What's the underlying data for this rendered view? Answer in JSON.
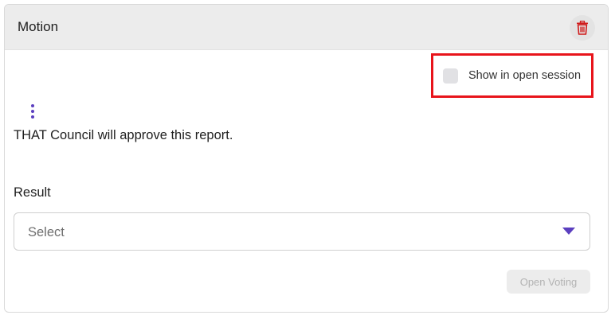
{
  "card": {
    "title": "Motion",
    "delete_icon": "trash-icon",
    "accent_color": "#5b3fbf",
    "delete_color": "#d01b1b"
  },
  "options": {
    "show_in_open_session_label": "Show in open session",
    "show_in_open_session_checked": false,
    "highlight_color": "#e8141b"
  },
  "motion": {
    "menu_icon": "kebab-menu-icon",
    "text": "THAT Council will approve this report."
  },
  "result": {
    "label": "Result",
    "select_placeholder": "Select",
    "dropdown_icon": "caret-down-icon"
  },
  "actions": {
    "open_voting_label": "Open Voting",
    "open_voting_enabled": false
  }
}
